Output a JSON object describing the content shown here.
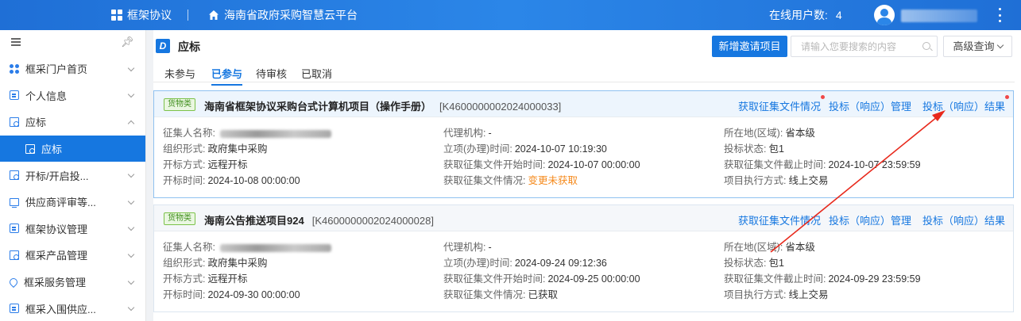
{
  "topbar": {
    "framework_label": "框架协议",
    "platform_label": "海南省政府采购智慧云平台",
    "online_users_label": "在线用户数:",
    "online_users_count": "4"
  },
  "sidebar": {
    "items": [
      {
        "label": "框采门户首页",
        "icon": "dots-icon"
      },
      {
        "label": "个人信息",
        "icon": "id-card-icon"
      },
      {
        "label": "应标",
        "icon": "doc-icon",
        "expanded": true
      },
      {
        "label": "应标",
        "icon": "doc-icon",
        "active": true
      },
      {
        "label": "开标/开启投...",
        "icon": "doc-icon"
      },
      {
        "label": "供应商评审等...",
        "icon": "monitor-icon"
      },
      {
        "label": "框架协议管理",
        "icon": "contract-icon"
      },
      {
        "label": "框采产品管理",
        "icon": "doc-icon"
      },
      {
        "label": "框采服务管理",
        "icon": "heart-icon"
      },
      {
        "label": "框采入围供应...",
        "icon": "list-icon"
      }
    ]
  },
  "main": {
    "title": "应标",
    "new_button": "新增邀请项目",
    "search_placeholder": "请输入您要搜索的内容",
    "advanced_search": "高级查询",
    "tabs": [
      "未参与",
      "已参与",
      "待审核",
      "已取消"
    ],
    "active_tab": "已参与",
    "actions": [
      "获取征集文件情况",
      "投标（响应）管理",
      "投标（响应）结果"
    ],
    "cards": [
      {
        "badge": "货物类",
        "title": "海南省框架协议采购台式计算机项目（操作手册）",
        "code": "[K4600000002024000033]",
        "fields": {
          "collector_label": "征集人名称:",
          "org_form_label": "组织形式:",
          "org_form": "政府集中采购",
          "open_method_label": "开标方式:",
          "open_method": "远程开标",
          "open_time_label": "开标时间:",
          "open_time": "2024-10-08 00:00:00",
          "agent_label": "代理机构:",
          "agent": "-",
          "approval_time_label": "立项(办理)时间:",
          "approval_time": "2024-10-07 10:19:30",
          "doc_start_label": "获取征集文件开始时间:",
          "doc_start": "2024-10-07 00:00:00",
          "doc_status_label": "获取征集文件情况:",
          "doc_status": "变更未获取",
          "region_label": "所在地(区域):",
          "region": "省本级",
          "bid_status_label": "投标状态:",
          "bid_status": "包1",
          "doc_end_label": "获取征集文件截止时间:",
          "doc_end": "2024-10-07 23:59:59",
          "exec_label": "项目执行方式:",
          "exec": "线上交易"
        }
      },
      {
        "badge": "货物类",
        "title": "海南公告推送项目924",
        "code": "[K4600000002024000028]",
        "fields": {
          "collector_label": "征集人名称:",
          "org_form_label": "组织形式:",
          "org_form": "政府集中采购",
          "open_method_label": "开标方式:",
          "open_method": "远程开标",
          "open_time_label": "开标时间:",
          "open_time": "2024-09-30 00:00:00",
          "agent_label": "代理机构:",
          "agent": "-",
          "approval_time_label": "立项(办理)时间:",
          "approval_time": "2024-09-24 09:12:36",
          "doc_start_label": "获取征集文件开始时间:",
          "doc_start": "2024-09-25 00:00:00",
          "doc_status_label": "获取征集文件情况:",
          "doc_status": "已获取",
          "region_label": "所在地(区域):",
          "region": "省本级",
          "bid_status_label": "投标状态:",
          "bid_status": "包1",
          "doc_end_label": "获取征集文件截止时间:",
          "doc_end": "2024-09-29 23:59:59",
          "exec_label": "项目执行方式:",
          "exec": "线上交易"
        }
      }
    ]
  },
  "colors": {
    "primary": "#1677e0",
    "topbar": "#2b86e8",
    "warning": "#f5891b",
    "badge_green": "#3f8f1d",
    "annotation_red": "#e8291c"
  }
}
